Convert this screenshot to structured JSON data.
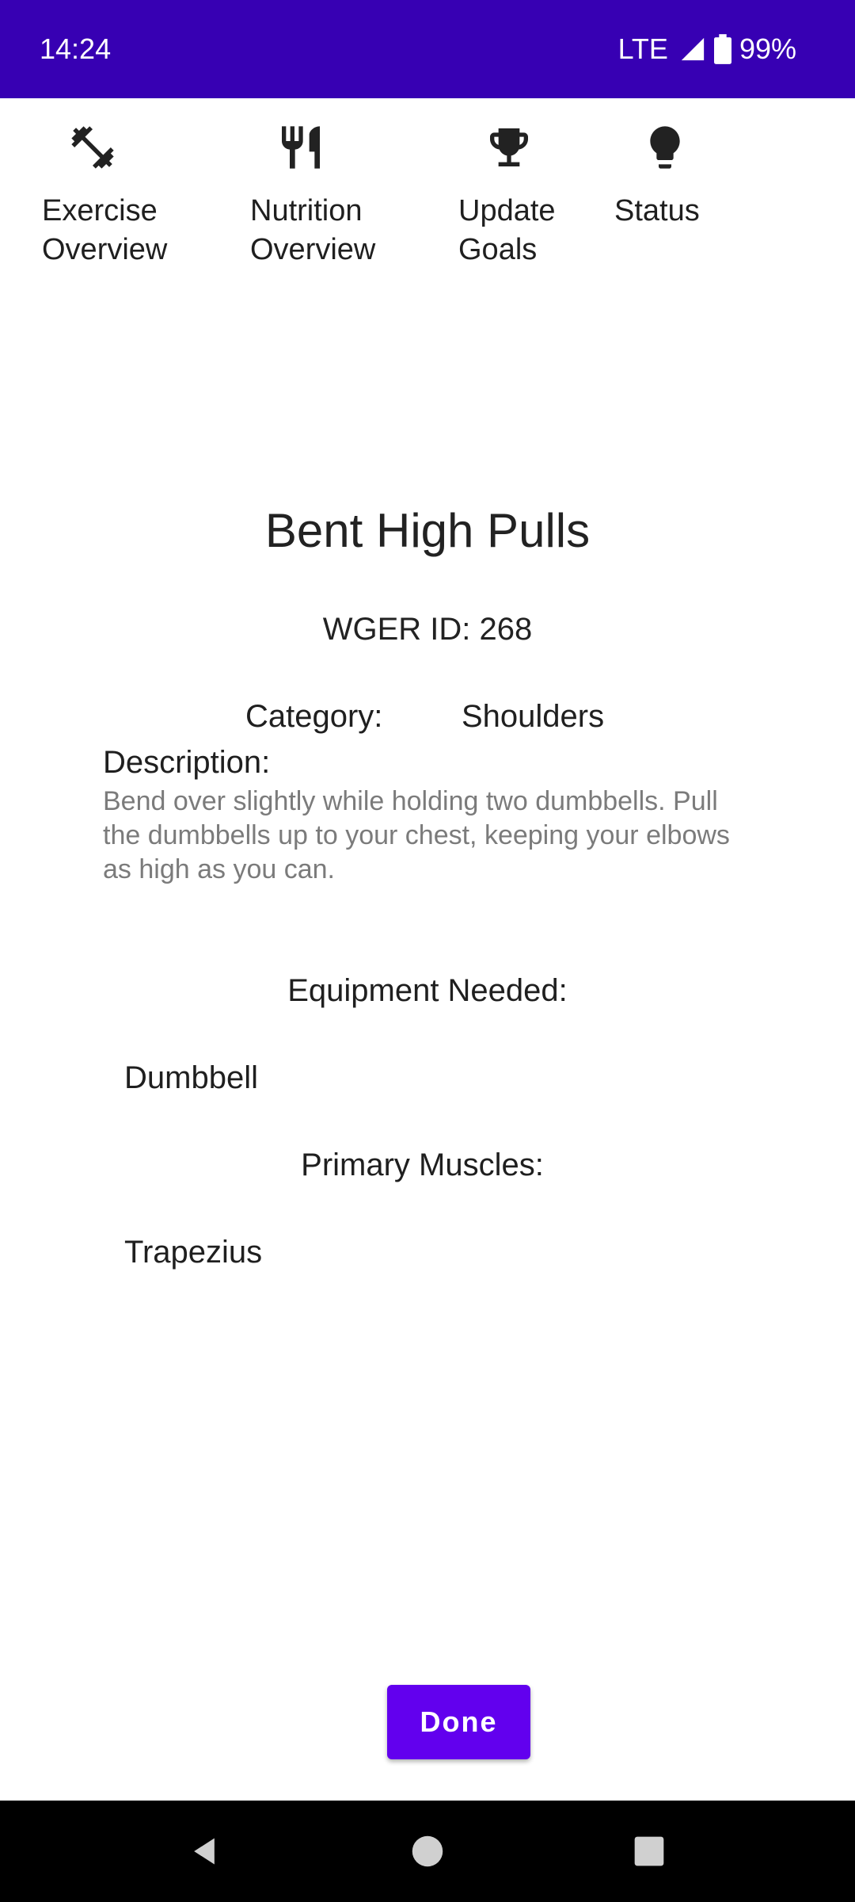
{
  "status_bar": {
    "time": "14:24",
    "network": "LTE",
    "battery": "99%",
    "icons": [
      "signal-icon",
      "battery-icon"
    ]
  },
  "nav": {
    "items": [
      {
        "label": "Exercise\nOverview",
        "icon": "dumbbell-icon"
      },
      {
        "label": "Nutrition\nOverview",
        "icon": "fork-knife-icon"
      },
      {
        "label": "Update\nGoals",
        "icon": "trophy-icon"
      },
      {
        "label": "Status",
        "icon": "lightbulb-icon"
      }
    ]
  },
  "exercise": {
    "name": "Bent High Pulls",
    "wger_id_text": "WGER ID: 268",
    "category_label": "Category:",
    "category_value": "Shoulders",
    "description_label": "Description:",
    "description": "Bend over slightly while holding two dumbbells. Pull the dumbbells up to your chest, keeping your elbows as high as you can.",
    "equipment_label": "Equipment Needed:",
    "equipment_value": "Dumbbell",
    "muscles_label": "Primary Muscles:",
    "muscles_value": "Trapezius"
  },
  "actions": {
    "done_label": "Done"
  },
  "system_nav": {
    "icons": [
      "back-icon",
      "home-icon",
      "recents-icon"
    ]
  },
  "colors": {
    "status_bar": "#3700b3",
    "accent": "#6200ee",
    "description_text": "#7b7b7b"
  }
}
